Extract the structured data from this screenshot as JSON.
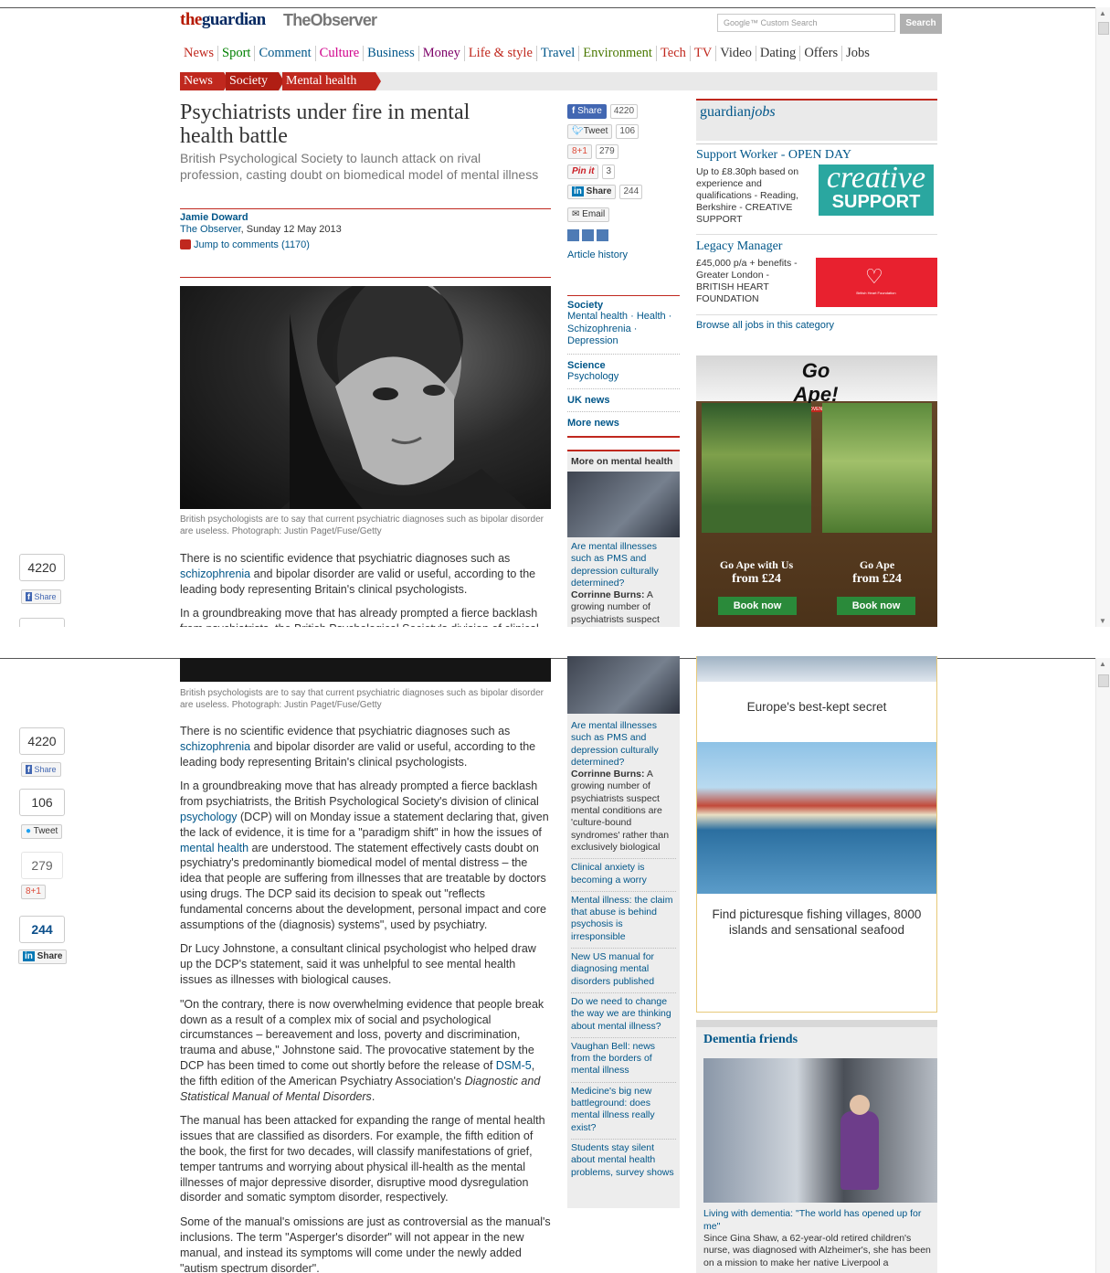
{
  "header": {
    "logo_the": "the",
    "logo_guardian": "guardian",
    "logo_observer": "TheObserver",
    "search_placeholder": "Google™ Custom Search",
    "search_button": "Search"
  },
  "nav": [
    "News",
    "Sport",
    "Comment",
    "Culture",
    "Business",
    "Money",
    "Life & style",
    "Travel",
    "Environment",
    "Tech",
    "TV",
    "Video",
    "Dating",
    "Offers",
    "Jobs"
  ],
  "nav_colors": [
    "#c0281e",
    "#008000",
    "#005689",
    "#d1008b",
    "#005689",
    "#7d0068",
    "#c0281e",
    "#005689",
    "#4a7801",
    "#c0281e",
    "#c0281e",
    "#333333",
    "#333333",
    "#333333",
    "#333333"
  ],
  "breadcrumb": [
    "News",
    "Society",
    "Mental health"
  ],
  "article": {
    "headline": "Psychiatrists under fire in mental health battle",
    "standfirst": "British Psychological Society to launch attack on rival profession, casting doubt on biomedical model of mental illness",
    "author": "Jamie Doward",
    "source": "The Observer",
    "date": ", Sunday 12 May 2013",
    "comments": "Jump to comments (1170)",
    "caption": "British psychologists are to say that current psychiatric diagnoses such as bipolar disorder are useless. Photograph: Justin Paget/Fuse/Getty",
    "p1_a": "There is no scientific evidence that psychiatric diagnoses such as ",
    "p1_link": "schizophrenia",
    "p1_b": " and bipolar disorder are valid or useful, according to the leading body representing Britain's clinical psychologists.",
    "p2_a": "In a groundbreaking move that has already prompted a fierce backlash from psychiatrists, the British Psychological Society's division of clinical ",
    "p2_link1": "psychology",
    "p2_b": " (DCP) will on Monday issue a statement declaring that, given the lack of evidence, it is time for a \"paradigm shift\" in how the issues of ",
    "p2_link2": "mental health",
    "p2_c": " are understood. The statement effectively casts doubt on psychiatry's predominantly biomedical model of mental distress – the idea that people are suffering from illnesses that are treatable by doctors using drugs. The DCP said its decision to speak out \"reflects fundamental concerns about the development, personal impact and core assumptions of the (diagnosis) systems\", used by psychiatry.",
    "p3": "Dr Lucy Johnstone, a consultant clinical psychologist who helped draw up the DCP's statement, said it was unhelpful to see mental health issues as illnesses with biological causes.",
    "p4_a": "\"On the contrary, there is now overwhelming evidence that people break down as a result of a complex mix of social and psychological circumstances – bereavement and loss, poverty and discrimination, trauma and abuse,\" Johnstone said. The provocative statement by the DCP has been timed to come out shortly before the release of ",
    "p4_link": "DSM-5",
    "p4_b": ", the fifth edition of the American Psychiatry Association's ",
    "p4_em": "Diagnostic and Statistical Manual of Mental Disorders",
    "p4_c": ".",
    "p5": "The manual has been attacked for expanding the range of mental health issues that are classified as disorders. For example, the fifth edition of the book, the first for two decades, will classify manifestations of grief, temper tantrums and worrying about physical ill-health as the mental illnesses of major depressive disorder, disruptive mood dysregulation disorder and somatic symptom disorder, respectively.",
    "p6": "Some of the manual's omissions are just as controversial as the manual's inclusions. The term \"Asperger's disorder\" will not appear in the new manual, and instead its symptoms will come under the newly added \"autism spectrum disorder\"."
  },
  "share": {
    "fb_label": "Share",
    "fb_count": "4220",
    "tw_label": "Tweet",
    "tw_count": "106",
    "gp_label": "8+1",
    "gp_count": "279",
    "pin_label": "Pin it",
    "pin_count": "3",
    "li_label": "Share",
    "li_count": "244",
    "email_label": "Email",
    "history": "Article history"
  },
  "side_tags": [
    {
      "head": "Society",
      "links": "Mental health · Health · Schizophrenia · Depression"
    },
    {
      "head": "Science",
      "links": "Psychology"
    },
    {
      "head": "UK news",
      "links": ""
    },
    {
      "head": "More news",
      "links": ""
    }
  ],
  "more_on": {
    "title": "More on mental health",
    "links": [
      "Are mental illnesses such as PMS and depression culturally determined?",
      "Clinical anxiety is becoming a worry",
      "Mental illness: the claim that abuse is behind psychosis is irresponsible",
      "New US manual for diagnosing mental disorders published",
      "Do we need to change the way we are thinking about mental illness?",
      "Vaughan Bell: news from the borders of mental illness",
      "Medicine's big new battleground: does mental illness really exist?",
      "Students stay silent about mental health problems, survey shows"
    ],
    "first_author": "Corrinne Burns:",
    "first_text": " A growing number of psychiatrists suspect mental conditions are 'culture-bound syndromes' rather than exclusively biological"
  },
  "jobs": {
    "brand_a": "guardian",
    "brand_b": "jobs",
    "j1_title": "Support Worker - OPEN DAY",
    "j1_text": "Up to £8.30ph based on experience and qualifications - Reading, Berkshire - CREATIVE SUPPORT",
    "j1_logo_a": "creative",
    "j1_logo_b": "SUPPORT",
    "j2_title": "Legacy Manager",
    "j2_text": "£45,000 p/a + benefits - Greater London - BRITISH HEART FOUNDATION",
    "j2_logo": "British Heart Foundation",
    "browse": "Browse all jobs in this category"
  },
  "ad_goape": {
    "logo": "Go Ape!",
    "tag": "LIVE LIFE ADVENTUROUSLY",
    "left_a": "Go Ape with Us",
    "left_b": "from £24",
    "right_a": "Go Ape",
    "right_b": "from £24",
    "btn": "Book now"
  },
  "ad_europe": {
    "title": "Europe's best-kept secret",
    "text": "Find picturesque fishing villages, 8000 islands and sensational seafood"
  },
  "dementia": {
    "title": "Dementia friends",
    "link": "Living with dementia: \"The world has opened up for me\"",
    "text": "Since Gina Shaw, a 62-year-old retired children's nurse, was diagnosed with Alzheimer's, she has been on a mission to make her native Liverpool a"
  },
  "float_share": {
    "fb": "4220",
    "fb_label": "Share",
    "tw": "106",
    "tw_label": "Tweet",
    "gp": "279",
    "gp_label": "8+1",
    "li": "244",
    "li_label": "Share"
  }
}
